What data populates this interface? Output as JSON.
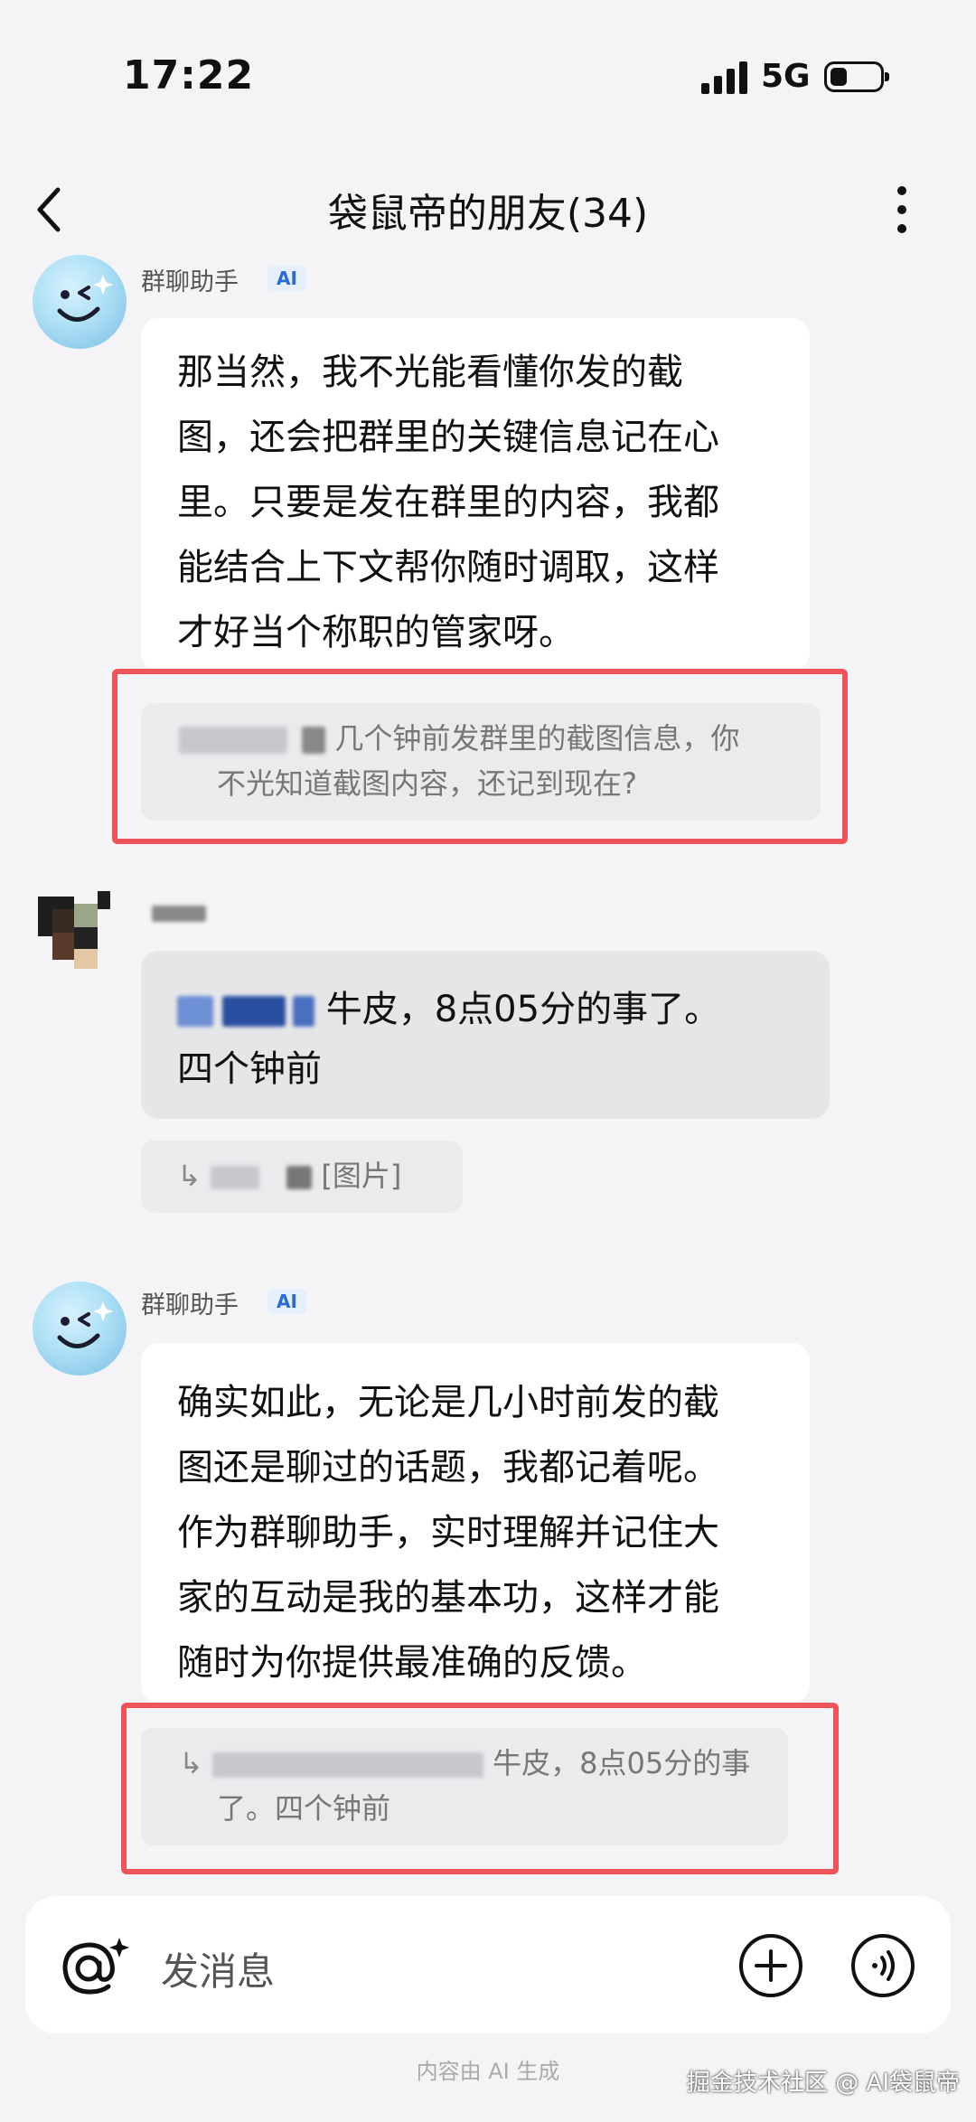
{
  "status_bar": {
    "time": "17:22",
    "network": "5G"
  },
  "nav": {
    "title": "袋鼠帝的朋友(34)"
  },
  "messages": [
    {
      "sender": "群聊助手",
      "badge": "AI",
      "lines": [
        "那当然，我不光能看懂你发的截",
        "图，还会把群里的关键信息记在心",
        "里。只要是发在群里的内容，我都",
        "能结合上下文帮你随时调取，这样",
        "才好当个称职的管家呀。"
      ],
      "quote_lines": [
        "几个钟前发群里的截图信息，你",
        "不光知道截图内容，还记到现在?"
      ]
    },
    {
      "text_lines": [
        "牛皮，8点05分的事了。",
        "四个钟前"
      ],
      "quote": "[图片]"
    },
    {
      "sender": "群聊助手",
      "badge": "AI",
      "lines": [
        "确实如此，无论是几小时前发的截",
        "图还是聊过的话题，我都记着呢。",
        "作为群聊助手，实时理解并记住大",
        "家的互动是我的基本功，这样才能",
        "随时为你提供最准确的反馈。"
      ],
      "quote_lines": [
        "牛皮，8点05分的事",
        "了。四个钟前"
      ]
    }
  ],
  "input": {
    "placeholder": "发消息"
  },
  "footer": {
    "note": "内容由 AI 生成",
    "watermark": "掘金技术社区 @ AI袋鼠帝"
  },
  "colors": {
    "highlight_box": "#f0545a",
    "ai_badge": "#2b6cd4"
  }
}
